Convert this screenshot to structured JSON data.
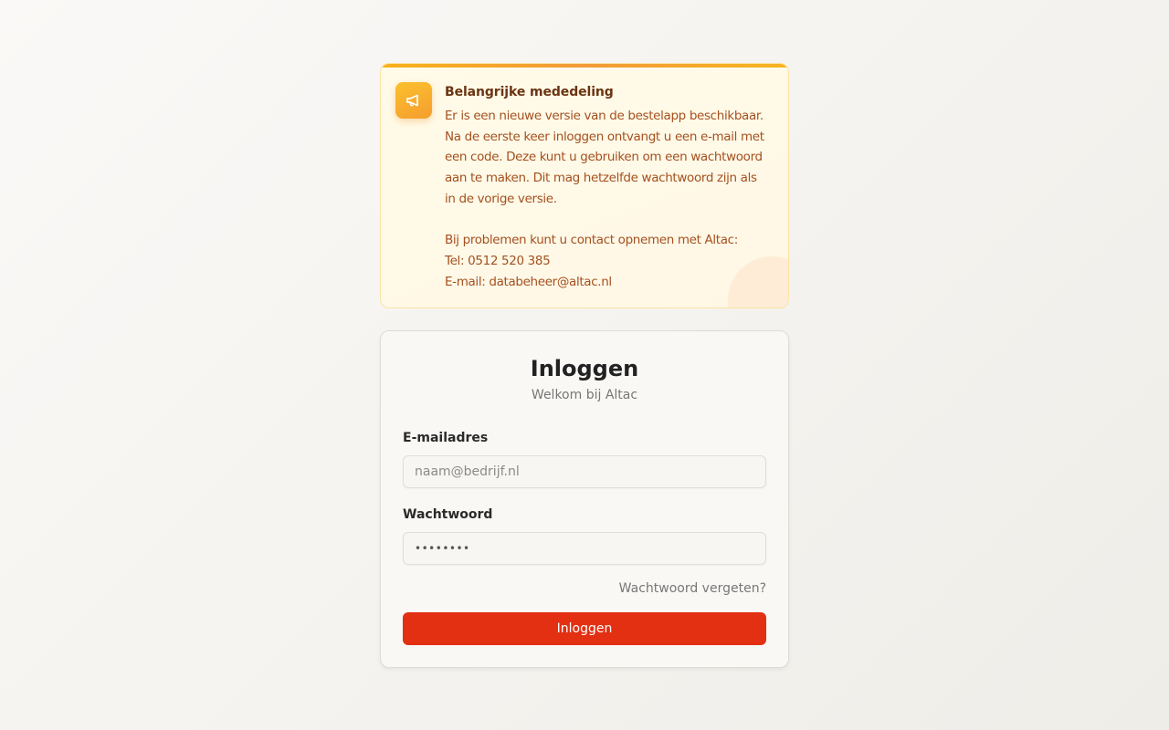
{
  "notice": {
    "icon": "megaphone-icon",
    "title": "Belangrijke mededeling",
    "lines_para1": [
      "Er is een nieuwe versie van de bestelapp beschikbaar.",
      "Na de eerste keer inloggen ontvangt u een e-mail met",
      "een code. Deze kunt u gebruiken om een wachtwoord",
      "aan te maken. Dit mag hetzelfde wachtwoord zijn als",
      "in de vorige versie."
    ],
    "lines_para2": [
      "Bij problemen kunt u contact opnemen met Altac:",
      "Tel: 0512 520 385",
      "E-mail: databeheer@altac.nl"
    ]
  },
  "login": {
    "title": "Inloggen",
    "subtitle": "Welkom bij Altac",
    "email_label": "E-mailadres",
    "email_placeholder": "naam@bedrijf.nl",
    "email_value": "",
    "password_label": "Wachtwoord",
    "password_value": "••••••••",
    "forgot_label": "Wachtwoord vergeten?",
    "submit_label": "Inloggen"
  },
  "colors": {
    "accent": "#e32f12",
    "notice_accent": "#f9b21a",
    "notice_text": "#a4501f"
  }
}
